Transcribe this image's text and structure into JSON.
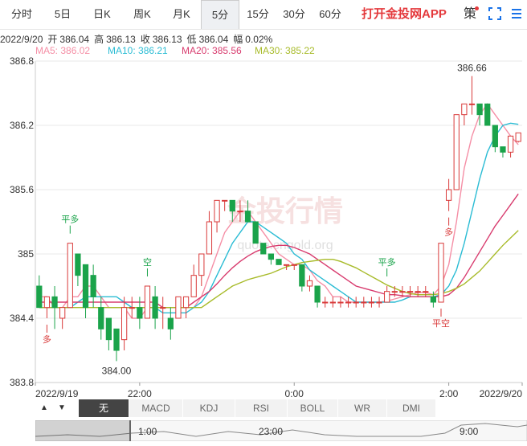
{
  "tabs": [
    {
      "label": "分时",
      "active": false
    },
    {
      "label": "5日",
      "active": false
    },
    {
      "label": "日K",
      "active": false
    },
    {
      "label": "周K",
      "active": false
    },
    {
      "label": "月K",
      "active": false
    },
    {
      "label": "5分",
      "active": true
    },
    {
      "label": "15分",
      "active": false
    },
    {
      "label": "30分",
      "active": false
    },
    {
      "label": "60分",
      "active": false
    }
  ],
  "promo": "打开金投网APP",
  "strategy": "策",
  "info": {
    "date": "2022/9/20",
    "open_label": "开",
    "open": "386.04",
    "high_label": "高",
    "high": "386.13",
    "close_label": "收",
    "close": "386.13",
    "low_label": "低",
    "low": "386.04",
    "amp_label": "幅",
    "amp": "0.02%"
  },
  "ma_legend": [
    {
      "text": "MA5: 386.02",
      "color": "#f58fa6"
    },
    {
      "text": "MA10: 386.21",
      "color": "#2bbcd4"
    },
    {
      "text": "MA20: 385.56",
      "color": "#d83b6e"
    },
    {
      "text": "MA30: 385.22",
      "color": "#a8bb2a"
    }
  ],
  "watermark": {
    "main": "金投行情",
    "sub": "quote.cngold.org"
  },
  "colors": {
    "up": "#d93a3a",
    "down": "#1aa34a",
    "grid": "#e8e8e8"
  },
  "chart_data": {
    "type": "candlestick",
    "ylim": [
      383.8,
      386.8
    ],
    "y_ticks": [
      "386.8",
      "386.2",
      "385.6",
      "385",
      "384.4",
      "383.8"
    ],
    "x_ticks": [
      "2022/9/19",
      "22:00",
      "0:00",
      "2:00",
      "2022/9/20"
    ],
    "annotations": {
      "high": "386.66",
      "low": "384.00"
    },
    "signals": [
      "平多",
      "空",
      "平多",
      "多",
      "平空",
      "多"
    ],
    "candles": [
      [
        384.7,
        384.8,
        384.6,
        384.5
      ],
      [
        384.5,
        384.6,
        384.4,
        384.6
      ],
      [
        384.6,
        384.7,
        384.3,
        384.5
      ],
      [
        384.4,
        384.5,
        384.3,
        384.5
      ],
      [
        384.5,
        385.1,
        384.5,
        385.1
      ],
      [
        385.0,
        385.0,
        384.7,
        384.8
      ],
      [
        384.9,
        384.9,
        384.4,
        384.5
      ],
      [
        384.8,
        384.9,
        384.5,
        384.6
      ],
      [
        384.5,
        384.6,
        384.2,
        384.3
      ],
      [
        384.4,
        384.4,
        384.1,
        384.2
      ],
      [
        384.3,
        384.3,
        384.0,
        384.1
      ],
      [
        384.2,
        384.6,
        384.1,
        384.5
      ],
      [
        384.5,
        384.6,
        384.4,
        384.5
      ],
      [
        384.5,
        384.6,
        384.3,
        384.4
      ],
      [
        384.4,
        384.7,
        384.4,
        384.7
      ],
      [
        384.6,
        384.7,
        384.3,
        384.4
      ],
      [
        384.5,
        384.6,
        384.3,
        384.5
      ],
      [
        384.4,
        384.5,
        384.2,
        384.3
      ],
      [
        384.4,
        384.6,
        384.4,
        384.6
      ],
      [
        384.5,
        384.6,
        384.4,
        384.6
      ],
      [
        384.6,
        384.9,
        384.6,
        384.8
      ],
      [
        384.8,
        385.0,
        384.7,
        385.0
      ],
      [
        385.0,
        385.4,
        385.0,
        385.3
      ],
      [
        385.3,
        385.5,
        385.2,
        385.5
      ],
      [
        385.5,
        385.5,
        385.4,
        385.5
      ],
      [
        385.5,
        385.5,
        385.3,
        385.4
      ],
      [
        385.4,
        385.5,
        385.3,
        385.4
      ],
      [
        385.4,
        385.5,
        385.3,
        385.3
      ],
      [
        385.3,
        385.3,
        385.1,
        385.1
      ],
      [
        385.1,
        385.1,
        385.0,
        385.0
      ],
      [
        385.0,
        385.0,
        384.9,
        384.95
      ],
      [
        384.95,
        384.95,
        384.9,
        384.9
      ],
      [
        384.9,
        384.9,
        384.85,
        384.9
      ],
      [
        384.9,
        384.9,
        384.85,
        384.9
      ],
      [
        384.9,
        384.9,
        384.65,
        384.7
      ],
      [
        384.7,
        384.8,
        384.65,
        384.75
      ],
      [
        384.7,
        384.7,
        384.5,
        384.55
      ],
      [
        384.55,
        384.6,
        384.5,
        384.55
      ],
      [
        384.55,
        384.6,
        384.5,
        384.55
      ],
      [
        384.55,
        384.6,
        384.5,
        384.55
      ],
      [
        384.55,
        384.6,
        384.5,
        384.55
      ],
      [
        384.55,
        384.6,
        384.5,
        384.55
      ],
      [
        384.55,
        384.6,
        384.5,
        384.55
      ],
      [
        384.55,
        384.6,
        384.5,
        384.55
      ],
      [
        384.55,
        384.6,
        384.5,
        384.55
      ],
      [
        384.55,
        384.7,
        384.55,
        384.65
      ],
      [
        384.65,
        384.7,
        384.6,
        384.65
      ],
      [
        384.65,
        384.7,
        384.6,
        384.65
      ],
      [
        384.65,
        384.7,
        384.6,
        384.65
      ],
      [
        384.65,
        384.7,
        384.6,
        384.65
      ],
      [
        384.65,
        384.7,
        384.6,
        384.65
      ],
      [
        384.6,
        384.65,
        384.5,
        384.55
      ],
      [
        384.55,
        385.1,
        384.55,
        385.1
      ],
      [
        385.5,
        385.7,
        385.4,
        385.6
      ],
      [
        385.6,
        386.3,
        385.6,
        386.3
      ],
      [
        386.3,
        386.4,
        386.2,
        386.4
      ],
      [
        386.4,
        386.66,
        386.3,
        386.4
      ],
      [
        386.4,
        386.4,
        386.2,
        386.3
      ],
      [
        386.4,
        386.4,
        386.2,
        386.2
      ],
      [
        386.2,
        386.2,
        385.95,
        386.0
      ],
      [
        386.0,
        386.0,
        385.9,
        385.95
      ],
      [
        385.95,
        386.1,
        385.9,
        386.1
      ],
      [
        386.05,
        386.13,
        386.04,
        386.13
      ]
    ],
    "series": [
      {
        "name": "MA5",
        "color": "#f58fa6",
        "values": [
          384.6,
          384.6,
          384.5,
          384.5,
          384.6,
          384.6,
          384.7,
          384.7,
          384.6,
          384.5,
          384.5,
          384.5,
          384.4,
          384.4,
          384.5,
          384.5,
          384.5,
          384.5,
          384.5,
          384.5,
          384.5,
          384.6,
          384.8,
          385.0,
          385.2,
          385.3,
          385.4,
          385.4,
          385.3,
          385.2,
          385.1,
          385.0,
          384.95,
          384.9,
          384.9,
          384.85,
          384.75,
          384.7,
          384.6,
          384.6,
          384.55,
          384.55,
          384.55,
          384.55,
          384.55,
          384.56,
          384.58,
          384.6,
          384.62,
          384.64,
          384.64,
          384.62,
          384.7,
          384.9,
          385.3,
          385.8,
          386.1,
          386.3,
          386.4,
          386.3,
          386.2,
          386.1,
          386.02
        ]
      },
      {
        "name": "MA10",
        "color": "#2bbcd4",
        "values": [
          384.5,
          384.5,
          384.5,
          384.5,
          384.5,
          384.55,
          384.6,
          384.6,
          384.6,
          384.6,
          384.6,
          384.55,
          384.5,
          384.5,
          384.5,
          384.5,
          384.45,
          384.45,
          384.45,
          384.45,
          384.5,
          384.55,
          384.65,
          384.8,
          384.95,
          385.1,
          385.2,
          385.3,
          385.3,
          385.25,
          385.2,
          385.15,
          385.1,
          385.0,
          384.95,
          384.85,
          384.8,
          384.75,
          384.7,
          384.65,
          384.6,
          384.55,
          384.55,
          384.55,
          384.55,
          384.55,
          384.55,
          384.57,
          384.6,
          384.6,
          384.6,
          384.6,
          384.62,
          384.7,
          384.85,
          385.1,
          385.4,
          385.7,
          385.95,
          386.1,
          386.2,
          386.22,
          386.21
        ]
      },
      {
        "name": "MA20",
        "color": "#d83b6e",
        "values": [
          384.55,
          384.55,
          384.55,
          384.55,
          384.55,
          384.55,
          384.55,
          384.55,
          384.55,
          384.55,
          384.55,
          384.55,
          384.55,
          384.55,
          384.55,
          384.55,
          384.5,
          384.5,
          384.5,
          384.5,
          384.55,
          384.6,
          384.65,
          384.72,
          384.8,
          384.87,
          384.93,
          384.98,
          385.02,
          385.05,
          385.07,
          385.08,
          385.08,
          385.06,
          385.03,
          385.0,
          384.95,
          384.9,
          384.85,
          384.8,
          384.75,
          384.7,
          384.68,
          384.66,
          384.64,
          384.62,
          384.62,
          384.61,
          384.6,
          384.6,
          384.6,
          384.6,
          384.6,
          384.62,
          384.68,
          384.78,
          384.9,
          385.02,
          385.14,
          385.26,
          385.36,
          385.46,
          385.56
        ]
      },
      {
        "name": "MA30",
        "color": "#a8bb2a",
        "values": [
          384.5,
          384.5,
          384.5,
          384.5,
          384.5,
          384.5,
          384.5,
          384.5,
          384.5,
          384.5,
          384.5,
          384.5,
          384.5,
          384.5,
          384.5,
          384.5,
          384.5,
          384.5,
          384.5,
          384.5,
          384.5,
          384.5,
          384.55,
          384.6,
          384.65,
          384.7,
          384.73,
          384.76,
          384.78,
          384.8,
          384.82,
          384.85,
          384.88,
          384.9,
          384.92,
          384.93,
          384.94,
          384.95,
          384.95,
          384.93,
          384.9,
          384.87,
          384.83,
          384.79,
          384.75,
          384.71,
          384.68,
          384.65,
          384.63,
          384.62,
          384.62,
          384.62,
          384.63,
          384.65,
          384.68,
          384.72,
          384.78,
          384.84,
          384.92,
          385.0,
          385.08,
          385.15,
          385.22
        ]
      }
    ]
  },
  "indicators": [
    "无",
    "MACD",
    "KDJ",
    "RSI",
    "BOLL",
    "WR",
    "DMI"
  ],
  "nav_ticks": [
    "1:00",
    "23:00",
    "9:00"
  ],
  "nav_arrows": [
    "▲",
    "▼"
  ]
}
